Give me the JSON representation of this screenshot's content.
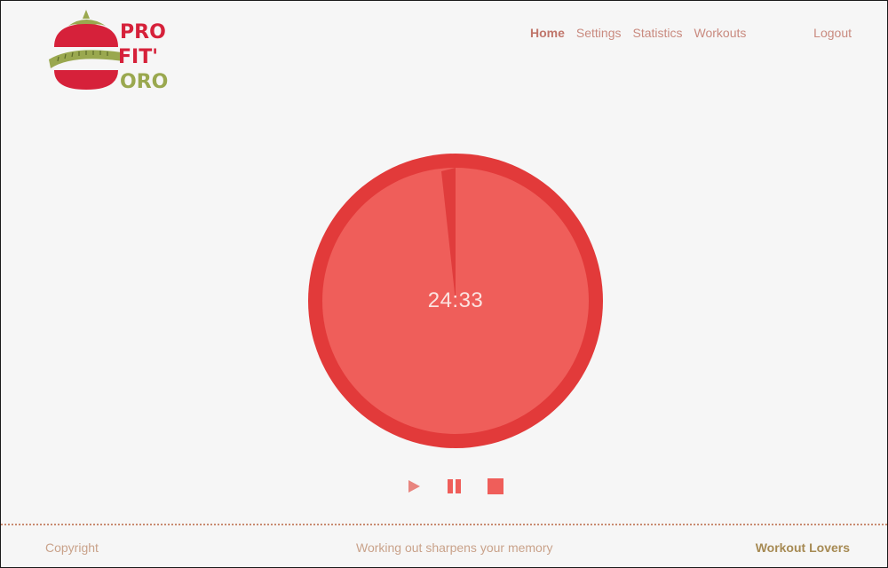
{
  "logo": {
    "line1": "PRO",
    "line2": "FIT'",
    "line3": "ORO",
    "icon": "tomato-measuring-tape-icon",
    "colors": {
      "red": "#d6213a",
      "green": "#9aa84f"
    }
  },
  "nav": {
    "items": [
      {
        "label": "Home",
        "active": true
      },
      {
        "label": "Settings",
        "active": false
      },
      {
        "label": "Statistics",
        "active": false
      },
      {
        "label": "Workouts",
        "active": false
      }
    ],
    "logout_label": "Logout"
  },
  "timer": {
    "time": "24:33",
    "colors": {
      "ring": "#e23a3a",
      "face": "#ef5e5a",
      "elapsed": "#e03c3c"
    }
  },
  "controls": {
    "play_icon": "play-icon",
    "pause_icon": "pause-icon",
    "stop_icon": "stop-icon",
    "color": "#ef5e5a"
  },
  "footer": {
    "copyright": "Copyright",
    "tagline": "Working out sharpens your memory",
    "brand": "Workout Lovers"
  }
}
